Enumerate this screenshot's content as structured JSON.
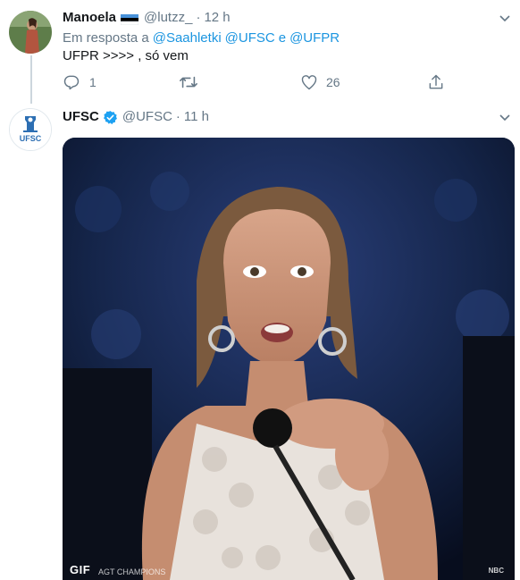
{
  "reply_tweet": {
    "display_name": "Manoela",
    "handle": "@lutzz_",
    "separator": "·",
    "time": "12 h",
    "reply_prefix": "Em resposta a",
    "mention_1": "@Saahletki",
    "mention_2": "@UFSC",
    "mention_and": "e",
    "mention_3": "@UFPR",
    "text": "UFPR >>>> , só vem",
    "reply_count": "1",
    "retweet_count": "",
    "like_count": "26"
  },
  "main_tweet": {
    "display_name": "UFSC",
    "handle": "@UFSC",
    "separator": "·",
    "time": "11 h",
    "avatar_text": "UFSC",
    "media_badge": "GIF",
    "media_watermark": "AGT CHAMPIONS",
    "media_network": "NBC"
  },
  "colors": {
    "accent": "#1b95e0",
    "verified": "#1da1f2",
    "muted": "#657786",
    "thread_line": "#ccd6dd"
  },
  "icons": [
    "estonia-flag-icon",
    "chevron-down-icon",
    "reply-icon",
    "retweet-icon",
    "like-icon",
    "share-icon",
    "verified-badge-icon"
  ]
}
